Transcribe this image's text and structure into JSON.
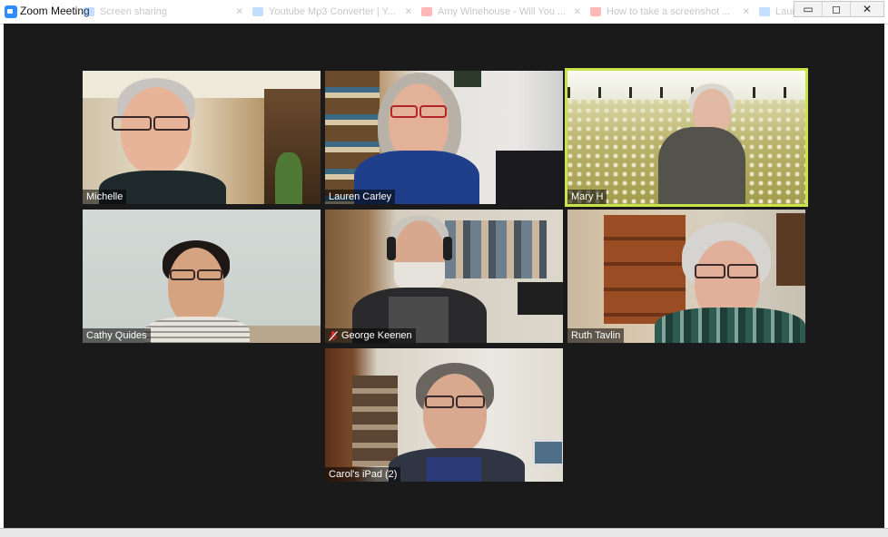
{
  "window": {
    "title": "Zoom Meeting",
    "controls": {
      "minimize": "▭",
      "maximize": "◻",
      "close": "✕"
    }
  },
  "background_tabs": [
    {
      "label": "Screen sharing",
      "icon": "zoom-icon",
      "color": "#2d8cff"
    },
    {
      "label": "Youtube Mp3 Converter | Y...",
      "icon": "zoom-icon",
      "color": "#2d8cff"
    },
    {
      "label": "Amy Winehouse - Will You ...",
      "icon": "youtube-icon",
      "color": "#ff0000"
    },
    {
      "label": "How to take a screenshot ...",
      "icon": "youtube-icon",
      "color": "#ff0000"
    },
    {
      "label": "Laura's Meeting - Zoom",
      "icon": "zoom-icon",
      "color": "#2d8cff"
    }
  ],
  "participants": [
    {
      "name": "Michelle",
      "muted": false,
      "active": false
    },
    {
      "name": "Lauren Carley",
      "muted": false,
      "active": false
    },
    {
      "name": "Mary H",
      "muted": false,
      "active": true
    },
    {
      "name": "Cathy Quides",
      "muted": false,
      "active": false
    },
    {
      "name": "George Keenen",
      "muted": true,
      "active": false
    },
    {
      "name": "Ruth Tavlin",
      "muted": false,
      "active": false
    },
    {
      "name": "Carol's iPad (2)",
      "muted": false,
      "active": false
    }
  ],
  "colors": {
    "meeting_bg": "#1a1a1a",
    "active_speaker": "#c9e34a",
    "zoom_blue": "#2d8cff",
    "muted_red": "#e02828"
  }
}
